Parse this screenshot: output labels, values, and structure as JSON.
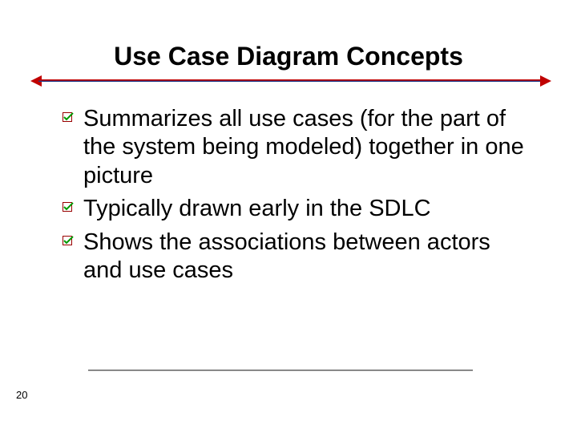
{
  "title": "Use Case Diagram Concepts",
  "bullets": [
    "Summarizes all use cases (for the part of the system being modeled) together in one picture",
    "Typically drawn early in the SDLC",
    "Shows the associations between actors and use cases"
  ],
  "page_number": "20"
}
